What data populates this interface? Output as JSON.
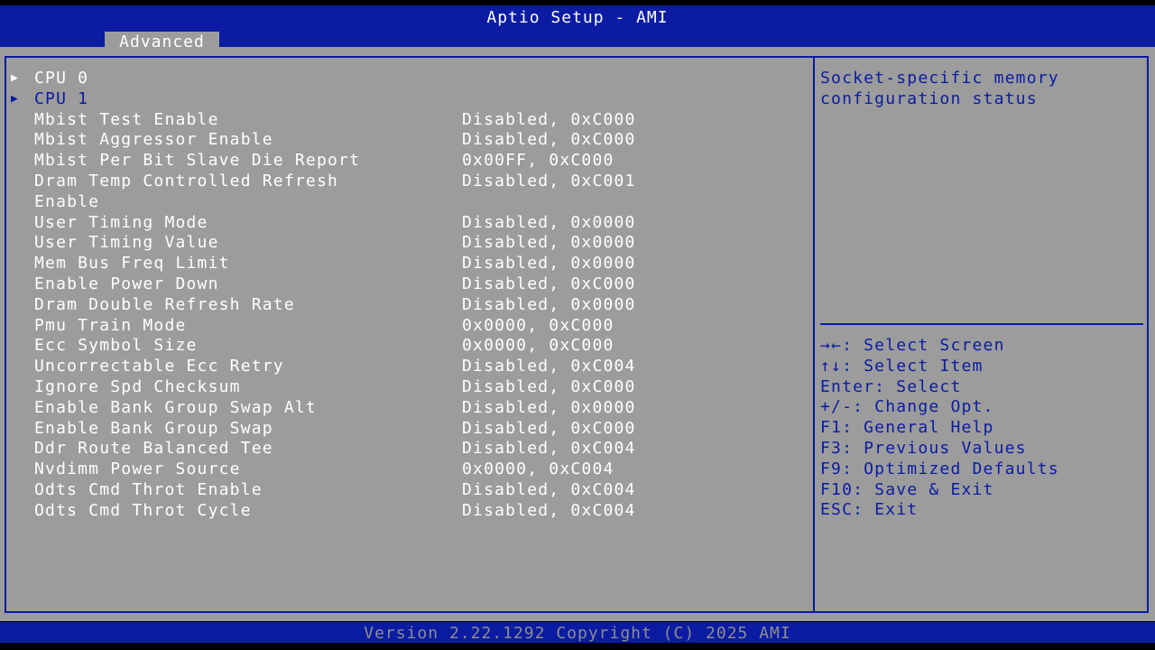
{
  "header": {
    "title": "Aptio Setup - AMI",
    "tab": "Advanced"
  },
  "menu": {
    "links": [
      {
        "label": "CPU 0"
      },
      {
        "label": "CPU 1"
      }
    ],
    "settings": [
      {
        "label": "Mbist Test Enable",
        "value": "Disabled, 0xC000"
      },
      {
        "label": "Mbist Aggressor Enable",
        "value": "Disabled, 0xC000"
      },
      {
        "label": "Mbist Per Bit Slave Die Report",
        "value": "0x00FF, 0xC000"
      },
      {
        "label": "Dram Temp Controlled Refresh",
        "label2": "Enable",
        "value": "Disabled, 0xC001"
      },
      {
        "label": "User Timing Mode",
        "value": "Disabled, 0x0000"
      },
      {
        "label": "User Timing Value",
        "value": "Disabled, 0x0000"
      },
      {
        "label": "Mem Bus Freq Limit",
        "value": "Disabled, 0x0000"
      },
      {
        "label": "Enable Power Down",
        "value": "Disabled, 0xC000"
      },
      {
        "label": "Dram Double Refresh Rate",
        "value": "Disabled, 0x0000"
      },
      {
        "label": "Pmu Train Mode",
        "value": "0x0000, 0xC000"
      },
      {
        "label": "Ecc Symbol Size",
        "value": "0x0000, 0xC000"
      },
      {
        "label": "Uncorrectable Ecc Retry",
        "value": "Disabled, 0xC004"
      },
      {
        "label": "Ignore Spd Checksum",
        "value": "Disabled, 0xC000"
      },
      {
        "label": "Enable Bank Group Swap Alt",
        "value": "Disabled, 0x0000"
      },
      {
        "label": "Enable Bank Group Swap",
        "value": "Disabled, 0xC000"
      },
      {
        "label": "Ddr Route Balanced Tee",
        "value": "Disabled, 0xC004"
      },
      {
        "label": "Nvdimm Power Source",
        "value": "0x0000, 0xC004"
      },
      {
        "label": "Odts Cmd Throt Enable",
        "value": "Disabled, 0xC004"
      },
      {
        "label": "Odts Cmd Throt Cycle",
        "value": "Disabled, 0xC004"
      }
    ]
  },
  "help": {
    "line1": "Socket-specific memory",
    "line2": "configuration status"
  },
  "keys": [
    "→←: Select Screen",
    "↑↓: Select Item",
    "Enter: Select",
    "+/-: Change Opt.",
    "F1: General Help",
    "F3: Previous Values",
    "F9: Optimized Defaults",
    "F10: Save & Exit",
    "ESC: Exit"
  ],
  "footer": {
    "text": "Version 2.22.1292 Copyright (C) 2025 AMI"
  }
}
